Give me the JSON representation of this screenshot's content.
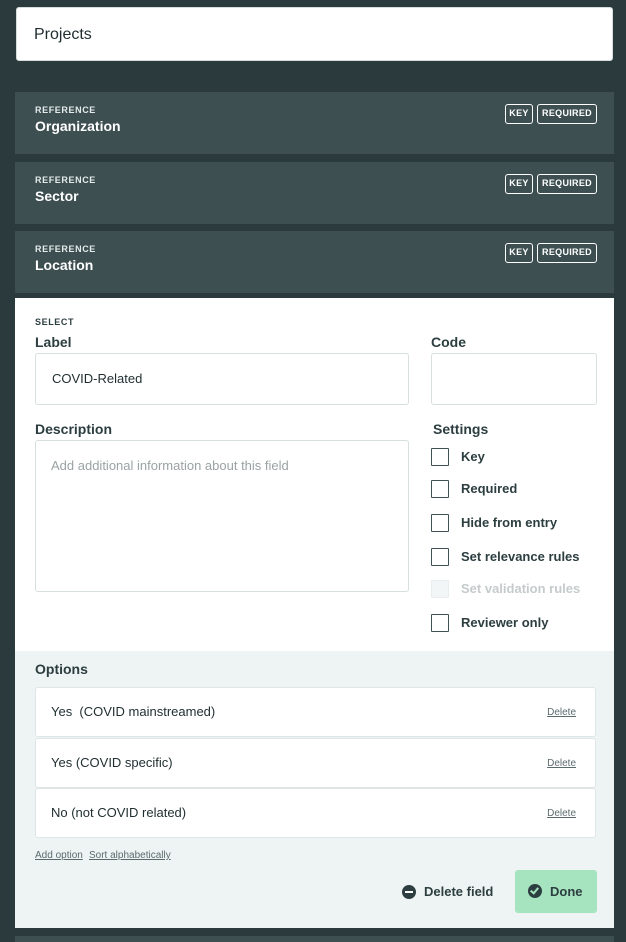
{
  "header": {
    "title": "Projects"
  },
  "reference_fields": [
    {
      "kind": "REFERENCE",
      "name": "Organization",
      "badges": [
        "KEY",
        "REQUIRED"
      ]
    },
    {
      "kind": "REFERENCE",
      "name": "Sector",
      "badges": [
        "KEY",
        "REQUIRED"
      ]
    },
    {
      "kind": "REFERENCE",
      "name": "Location",
      "badges": [
        "KEY",
        "REQUIRED"
      ]
    }
  ],
  "field_editor": {
    "kind": "SELECT",
    "label_title": "Label",
    "label_value": "COVID-Related",
    "code_title": "Code",
    "code_value": "",
    "description_title": "Description",
    "description_placeholder": "Add additional information about this field",
    "settings_title": "Settings",
    "settings": [
      {
        "label": "Key",
        "checked": false,
        "disabled": false
      },
      {
        "label": "Required",
        "checked": false,
        "disabled": false
      },
      {
        "label": "Hide from entry",
        "checked": false,
        "disabled": false
      },
      {
        "label": "Set relevance rules",
        "checked": false,
        "disabled": false
      },
      {
        "label": "Set validation rules",
        "checked": false,
        "disabled": true
      },
      {
        "label": "Reviewer only",
        "checked": false,
        "disabled": false
      }
    ],
    "options_title": "Options",
    "options": [
      {
        "label": "Yes  (COVID mainstreamed)",
        "delete_label": "Delete"
      },
      {
        "label": "Yes (COVID specific)",
        "delete_label": "Delete"
      },
      {
        "label": "No (not COVID related)",
        "delete_label": "Delete"
      }
    ],
    "add_option_label": "Add option",
    "sort_label": "Sort alphabetically",
    "delete_field_label": "Delete field",
    "done_label": "Done"
  },
  "colors": {
    "background": "#2b3a3d",
    "reference_row": "#3e4f52",
    "options_bg": "#eef3f3",
    "done_button": "#a6e4c0",
    "text": "#2c3e40"
  }
}
